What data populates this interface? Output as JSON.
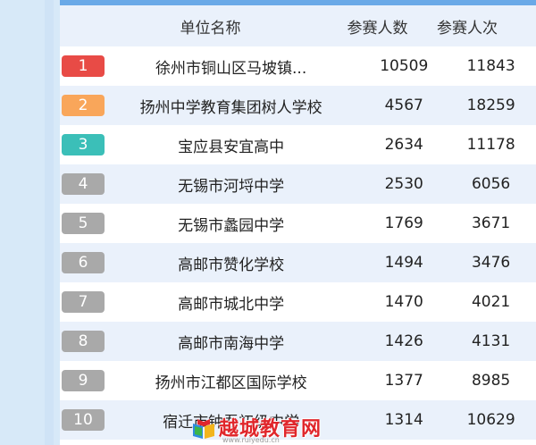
{
  "header": {
    "name": "单位名称",
    "participants": "参赛人数",
    "attempts": "参赛人次"
  },
  "colors": {
    "rank1": "#e84b46",
    "rank2": "#f9a65a",
    "rank3": "#3bbfb8",
    "rank_other": "#a9a9a9",
    "header_border": "#6aa9e7",
    "watermark": "#e0262b"
  },
  "rows": [
    {
      "rank": "1",
      "name": "徐州市铜山区马坡镇...",
      "participants": "10509",
      "attempts": "11843"
    },
    {
      "rank": "2",
      "name": "扬州中学教育集团树人学校",
      "participants": "4567",
      "attempts": "18259"
    },
    {
      "rank": "3",
      "name": "宝应县安宜高中",
      "participants": "2634",
      "attempts": "11178"
    },
    {
      "rank": "4",
      "name": "无锡市河埒中学",
      "participants": "2530",
      "attempts": "6056"
    },
    {
      "rank": "5",
      "name": "无锡市蠡园中学",
      "participants": "1769",
      "attempts": "3671"
    },
    {
      "rank": "6",
      "name": "高邮市赞化学校",
      "participants": "1494",
      "attempts": "3476"
    },
    {
      "rank": "7",
      "name": "高邮市城北中学",
      "participants": "1470",
      "attempts": "4021"
    },
    {
      "rank": "8",
      "name": "高邮市南海中学",
      "participants": "1426",
      "attempts": "4131"
    },
    {
      "rank": "9",
      "name": "扬州市江都区国际学校",
      "participants": "1377",
      "attempts": "8985"
    },
    {
      "rank": "10",
      "name": "宿迁市钟吾初级中学",
      "participants": "1314",
      "attempts": "10629"
    }
  ],
  "watermark": {
    "text": "越城教育网",
    "url": "www.ruiyedu.cn"
  }
}
